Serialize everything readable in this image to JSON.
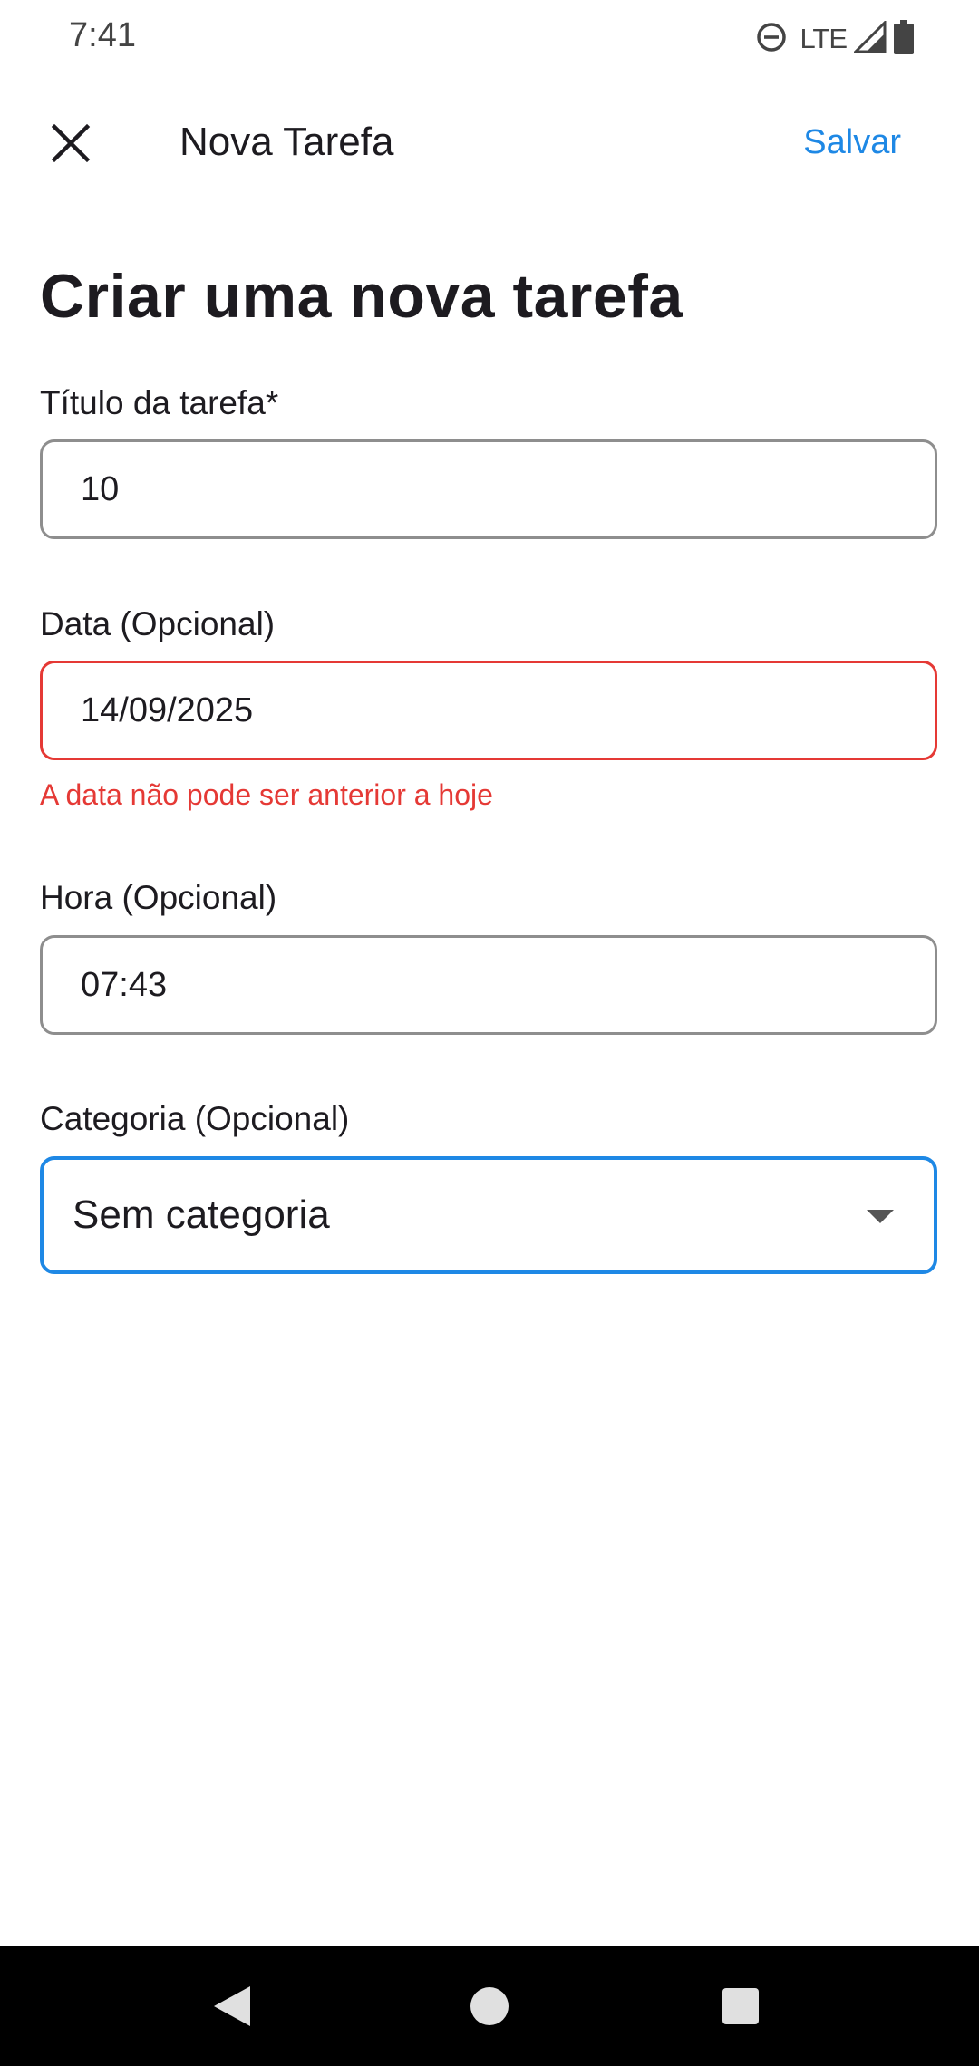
{
  "status_bar": {
    "time": "7:41",
    "network": "LTE",
    "icons": [
      "do-not-disturb-icon",
      "signal-icon",
      "battery-icon"
    ]
  },
  "app_bar": {
    "close_icon": "close-icon",
    "title": "Nova Tarefa",
    "save_label": "Salvar"
  },
  "form": {
    "heading": "Criar uma nova tarefa",
    "title_field": {
      "label": "Título da tarefa*",
      "value": "10"
    },
    "date_field": {
      "label": "Data (Opcional)",
      "value": "14/09/2025",
      "error": "A data não pode ser anterior a hoje"
    },
    "time_field": {
      "label": "Hora (Opcional)",
      "value": "07:43"
    },
    "category_field": {
      "label": "Categoria (Opcional)",
      "selected": "Sem categoria",
      "icon": "chevron-down-icon"
    }
  },
  "nav_bar": {
    "icons": [
      "back-icon",
      "home-icon",
      "recents-icon"
    ]
  },
  "colors": {
    "accent": "#1e88e5",
    "error": "#e53935",
    "field_border": "#8e8e8e",
    "text": "#1d1b20",
    "nav_background": "#000000"
  }
}
